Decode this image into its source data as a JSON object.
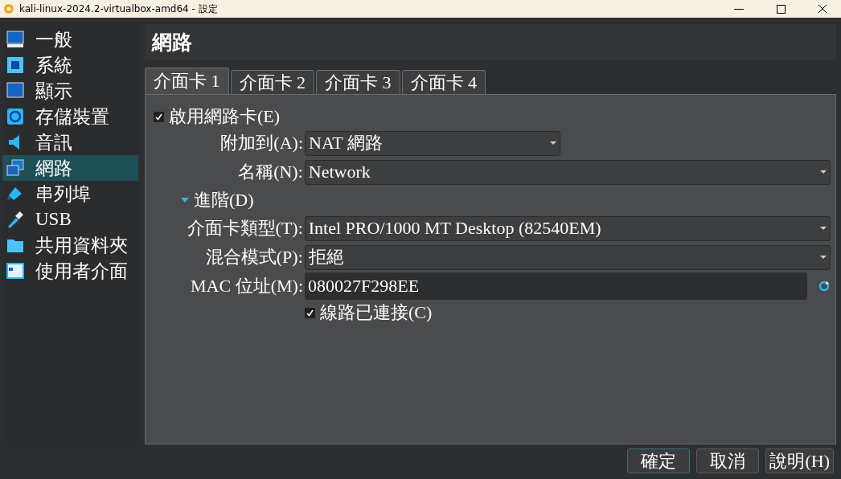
{
  "window": {
    "title": "kali-linux-2024.2-virtualbox-amd64 - 設定"
  },
  "sidebar": {
    "items": [
      {
        "label": "一般",
        "selected": false
      },
      {
        "label": "系統",
        "selected": false
      },
      {
        "label": "顯示",
        "selected": false
      },
      {
        "label": "存儲裝置",
        "selected": false
      },
      {
        "label": "音訊",
        "selected": false
      },
      {
        "label": "網路",
        "selected": true
      },
      {
        "label": "串列埠",
        "selected": false
      },
      {
        "label": "USB",
        "selected": false
      },
      {
        "label": "共用資料夾",
        "selected": false
      },
      {
        "label": "使用者介面",
        "selected": false
      }
    ]
  },
  "page": {
    "title": "網路"
  },
  "tabs": [
    {
      "label": "介面卡 1",
      "selected": true
    },
    {
      "label": "介面卡 2",
      "selected": false
    },
    {
      "label": "介面卡 3",
      "selected": false
    },
    {
      "label": "介面卡 4",
      "selected": false
    }
  ],
  "enable_adapter": {
    "label": "啟用網路卡(E)",
    "checked": true
  },
  "attached_to": {
    "label": "附加到(A):",
    "kind": "combo",
    "value": "NAT 網路"
  },
  "name": {
    "label": "名稱(N):",
    "kind": "combo",
    "value": "Network"
  },
  "advanced": {
    "label": "進階(D)",
    "expanded": true
  },
  "advanced_rows": [
    {
      "label": "介面卡類型(T):",
      "kind": "combo",
      "value": "Intel PRO/1000 MT Desktop (82540EM)"
    },
    {
      "label": "混合模式(P):",
      "kind": "combo",
      "value": "拒絕"
    },
    {
      "label": "MAC 位址(M):",
      "kind": "field",
      "value": "080027F298EE"
    }
  ],
  "cable_connected": {
    "label": "線路已連接(C)",
    "checked": true
  },
  "buttons": [
    {
      "label": "確定",
      "default": true
    },
    {
      "label": "取消",
      "default": false
    },
    {
      "label": "說明(H)",
      "default": false
    }
  ]
}
